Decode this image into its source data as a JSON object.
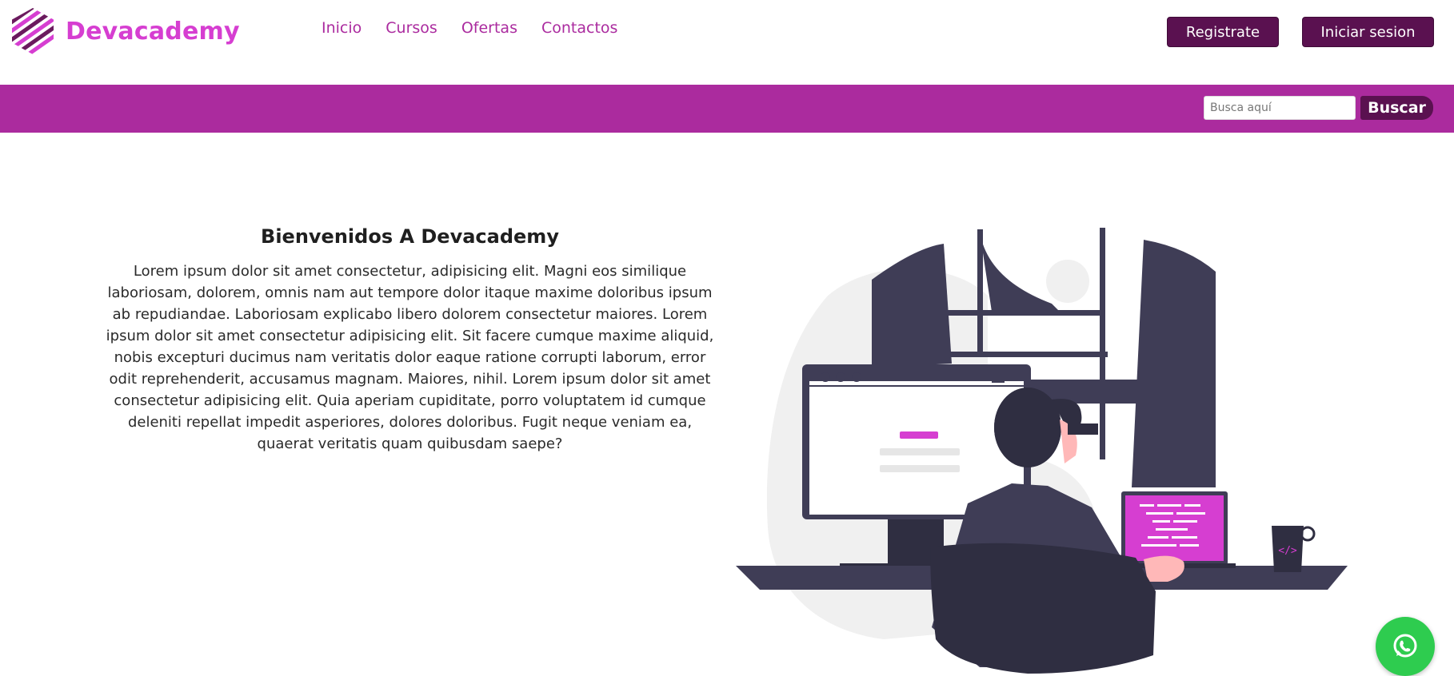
{
  "header": {
    "brand_name": "Devacademy",
    "logo_icon": "hexagon-stripes-logo",
    "nav": [
      {
        "label": "Inicio"
      },
      {
        "label": "Cursos"
      },
      {
        "label": "Ofertas"
      },
      {
        "label": "Contactos"
      }
    ],
    "register_label": "Registrate",
    "login_label": "Iniciar sesion"
  },
  "search": {
    "placeholder": "Busca aquí",
    "value": "",
    "button_label": "Buscar"
  },
  "hero": {
    "title": "Bienvenidos A Devacademy",
    "body": "Lorem ipsum dolor sit amet consectetur, adipisicing elit. Magni eos similique laboriosam, dolorem, omnis nam aut tempore dolor itaque maxime doloribus ipsum ab repudiandae. Laboriosam explicabo libero dolorem consectetur maiores. Lorem ipsum dolor sit amet consectetur adipisicing elit. Sit facere cumque maxime aliquid, nobis excepturi ducimus nam veritatis dolor eaque ratione corrupti laborum, error odit reprehenderit, accusamus magnam. Maiores, nihil. Lorem ipsum dolor sit amet consectetur adipisicing elit. Quia aperiam cupiditate, porro voluptatem id cumque deleniti repellat impedit asperiores, dolores doloribus. Fugit neque veniam ea, quaerat veritatis quam quibusdam saepe?",
    "illustration_icon": "developer-at-desk-illustration",
    "mug_code_glyph": "</>"
  },
  "floating": {
    "whatsapp_icon": "whatsapp-icon"
  },
  "colors": {
    "brand_pink": "#d63ed1",
    "nav_purple": "#ab2b9f",
    "search_bar_bg": "#ab2b9e",
    "button_dark": "#5a1150",
    "whatsapp_green": "#2ecc4f"
  }
}
